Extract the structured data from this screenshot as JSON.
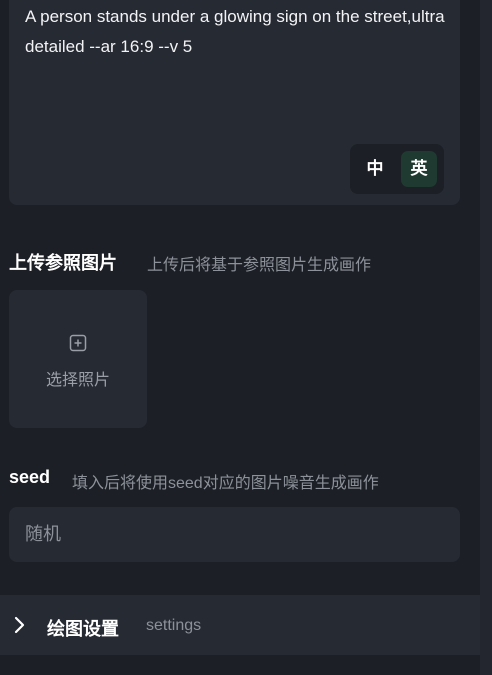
{
  "prompt": {
    "text": "A person stands under a glowing sign on the street,ultra detailed --ar 16:9 --v 5"
  },
  "language_toggle": {
    "zh_label": "中",
    "en_label": "英",
    "active": "en"
  },
  "reference_image": {
    "title": "上传参照图片",
    "hint": "上传后将基于参照图片生成画作",
    "upload_label": "选择照片",
    "upload_icon": "plus-square-icon"
  },
  "seed": {
    "title": "seed",
    "hint": "填入后将使用seed对应的图片噪音生成画作",
    "placeholder": "随机"
  },
  "drawing_settings": {
    "title": "绘图设置",
    "subtitle": "settings",
    "icon": "chevron-right-icon"
  },
  "colors": {
    "background": "#1c1f26",
    "panel": "#262a33",
    "active_toggle": "#1f3a31",
    "muted_text": "#8d9199"
  }
}
